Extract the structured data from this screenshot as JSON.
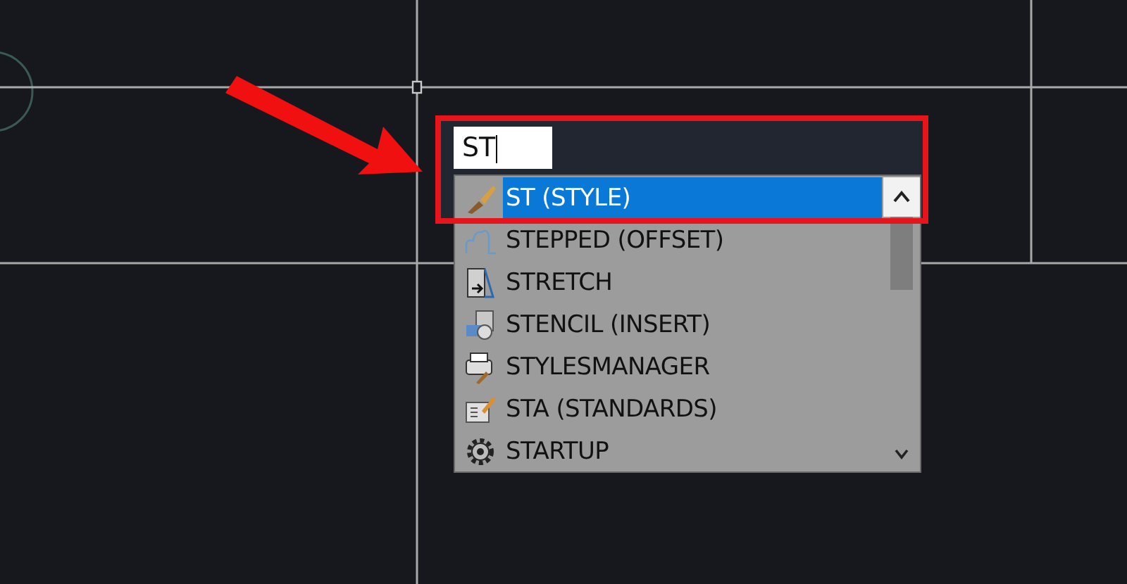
{
  "command_input": {
    "value": "ST"
  },
  "suggestions": [
    {
      "label": "ST (STYLE)",
      "selected": true
    },
    {
      "label": "STEPPED (OFFSET)",
      "selected": false
    },
    {
      "label": "STRETCH",
      "selected": false
    },
    {
      "label": "STENCIL (INSERT)",
      "selected": false
    },
    {
      "label": "STYLESMANAGER",
      "selected": false
    },
    {
      "label": "STA (STANDARDS)",
      "selected": false
    },
    {
      "label": "STARTUP",
      "selected": false
    }
  ]
}
